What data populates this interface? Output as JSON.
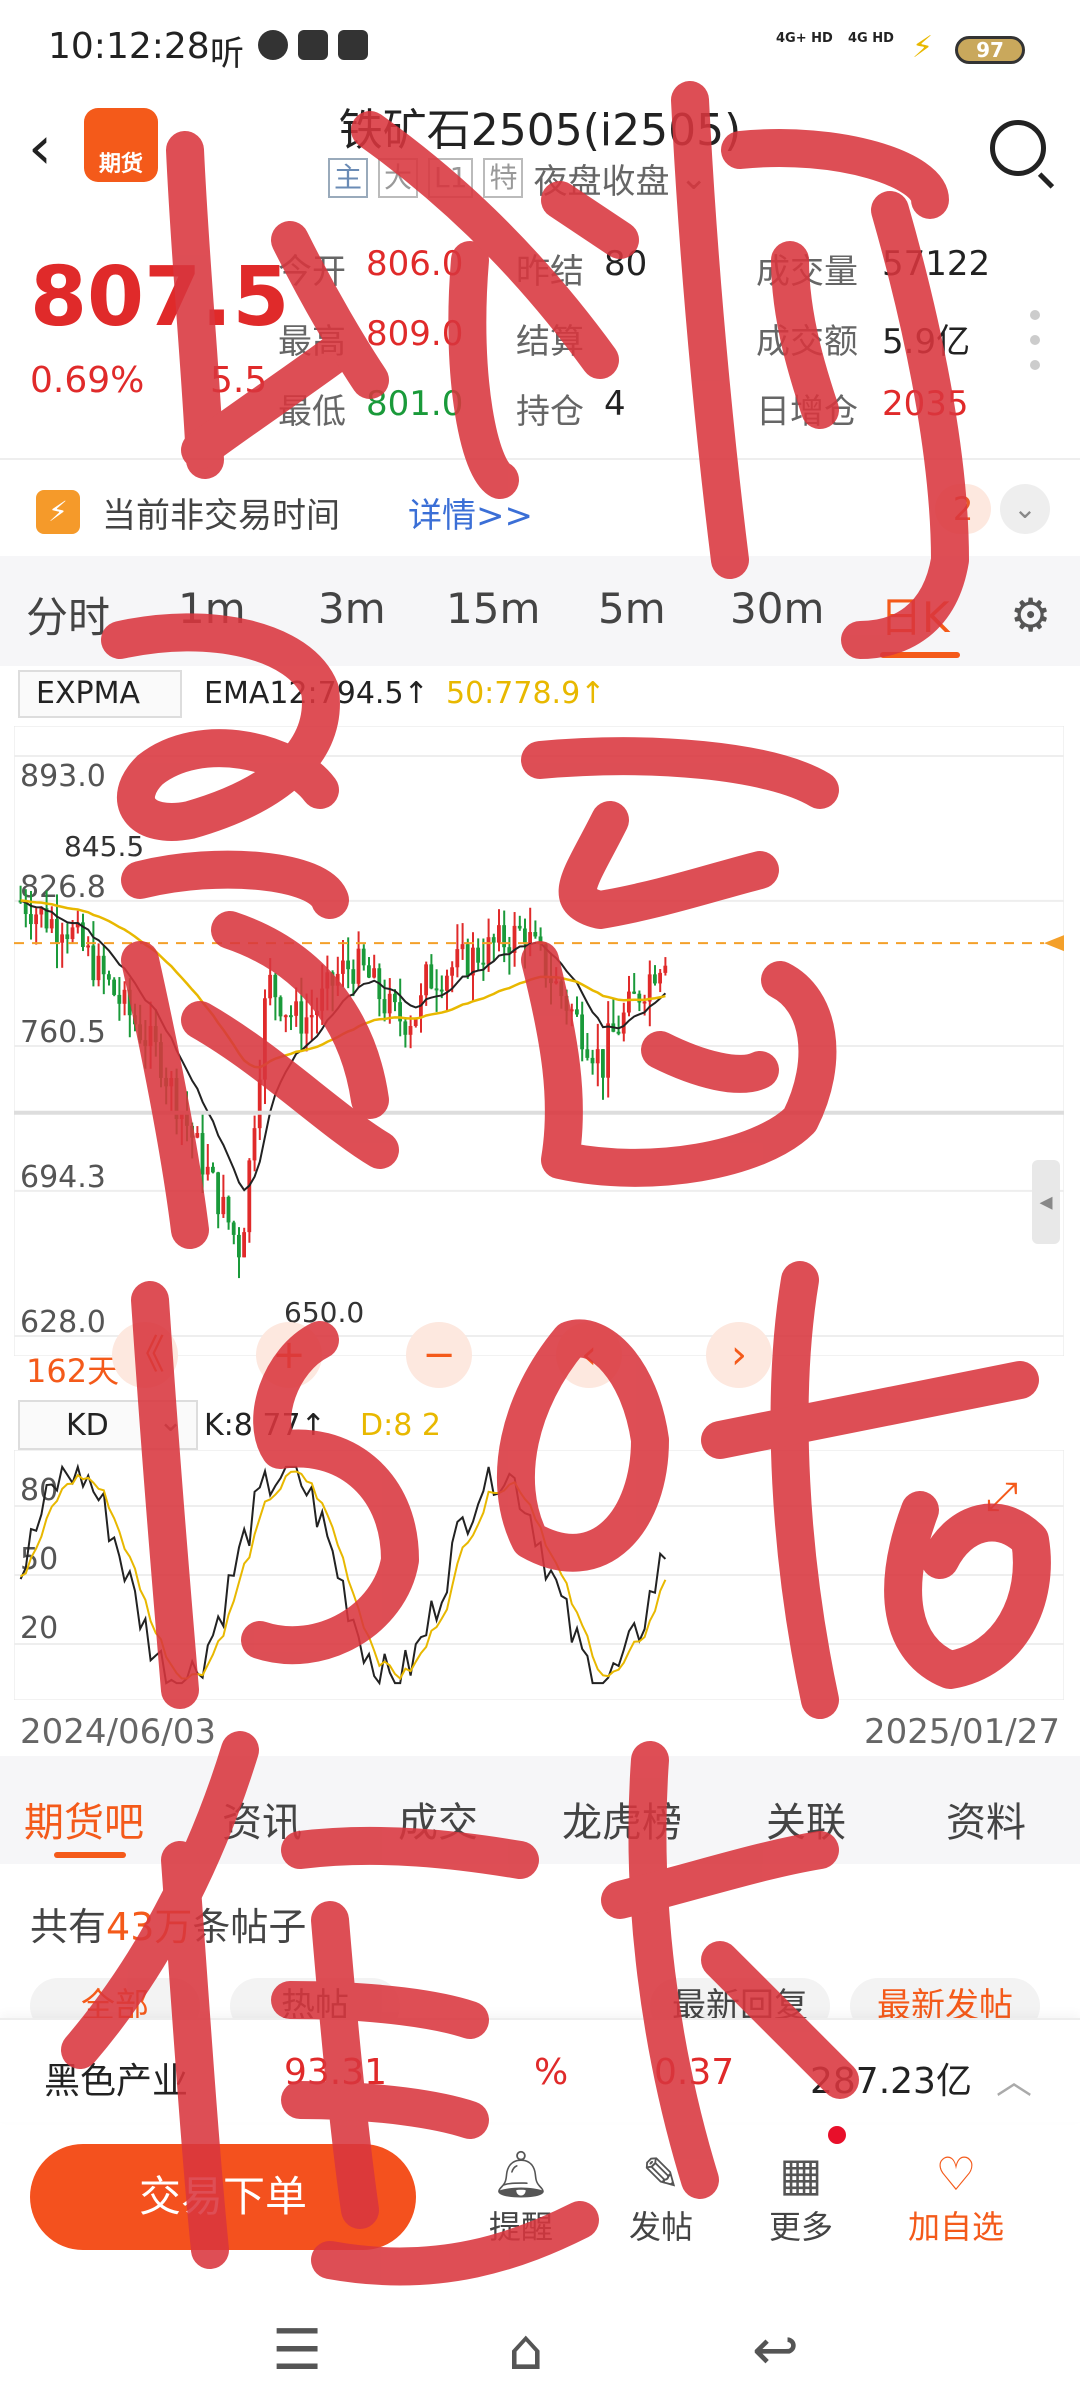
{
  "status_bar": {
    "time": "10:12:28",
    "app_hint": "听",
    "sig1": "4G+ HD",
    "sig2": "4G HD",
    "battery": "97"
  },
  "header": {
    "logo_text": "期货",
    "title": "铁矿石2505(i2505)",
    "tags": [
      "主",
      "大",
      "L1",
      "特"
    ],
    "session": "夜盘收盘"
  },
  "quote": {
    "price": "807.5",
    "pct": "0.69%",
    "change": "5.5",
    "rows": [
      [
        {
          "label": "今开",
          "value": "806.0",
          "color": "red"
        },
        {
          "label": "昨结",
          "value": "80",
          "color": "dark"
        },
        {
          "label": "成交量",
          "value": "57122",
          "color": "dark"
        }
      ],
      [
        {
          "label": "最高",
          "value": "809.0",
          "color": "red"
        },
        {
          "label": "结算",
          "value": "",
          "color": "dark"
        },
        {
          "label": "成交额",
          "value": "5.9亿",
          "color": "dark"
        }
      ],
      [
        {
          "label": "最低",
          "value": "801.0",
          "color": "green"
        },
        {
          "label": "持仓",
          "value": "4",
          "color": "dark"
        },
        {
          "label": "日增仓",
          "value": "2035",
          "color": "red"
        }
      ]
    ]
  },
  "notice": {
    "text": "当前非交易时间",
    "link": "详情>>",
    "count": "2"
  },
  "period_tabs": [
    "分时",
    "1m",
    "3m",
    "15m",
    "5m",
    "30m",
    "日K"
  ],
  "indicator": {
    "name": "EXPMA",
    "ema12": "EMA12:794.5↑",
    "ema50": "50:778.9↑"
  },
  "kd_indicator": {
    "name": "KD",
    "k": "K:8 77↑",
    "d": "D:8 2"
  },
  "chart_data": {
    "type": "candlestick",
    "y_ticks": [
      "893.0",
      "826.8",
      "760.5",
      "694.3",
      "628.0"
    ],
    "ylim": [
      628.0,
      893.0
    ],
    "annotations": {
      "high": "845.5",
      "low": "650.0"
    },
    "current_line": 807.5,
    "days": "162天",
    "kd_ticks": [
      "80",
      "50",
      "20"
    ],
    "x_start": "2024/06/03",
    "x_end": "2025/01/27"
  },
  "zoom_buttons": [
    "《",
    "+",
    "−",
    "‹",
    "›"
  ],
  "bottom_tabs": [
    "期货吧",
    "资讯",
    "成交",
    "龙虎榜",
    "关联",
    "资料"
  ],
  "posts": {
    "prefix": "共有",
    "count": "43万",
    "suffix": "条帖子"
  },
  "post_filters": [
    "全部",
    "热帖",
    "最新回复",
    "最新发帖"
  ],
  "sector": {
    "name": "黑色产业",
    "value": "93.31",
    "pct": "%",
    "change": "0.37",
    "amount": "287.23亿"
  },
  "actions": {
    "trade": "交易下单",
    "remind": "提醒",
    "post": "发帖",
    "more": "更多",
    "watch": "加自选"
  },
  "overlay_text": "以前最高1500估值点",
  "colors": {
    "accent": "#f45a1a",
    "up": "#e02a2a",
    "down": "#1a9a3a",
    "scribble": "#d9363e"
  }
}
